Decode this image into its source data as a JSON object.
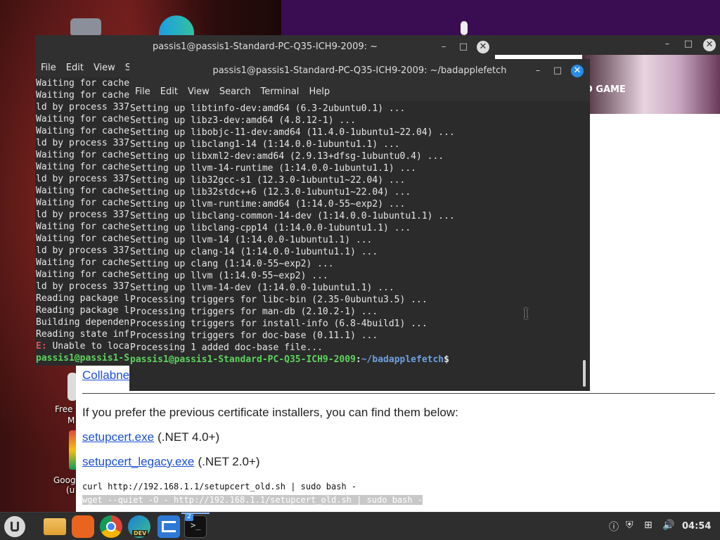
{
  "desktop": {
    "labels": [
      "Free",
      "M",
      "Goog",
      "(u"
    ]
  },
  "browser": {
    "banner_text": "D GAME",
    "link_partial": "Collabne",
    "prefer_text": "If you prefer the previous certificate installers, you can find them below:",
    "links": [
      {
        "label": "setupcert.exe",
        "note": "(.NET 4.0+)"
      },
      {
        "label": "setupcert_legacy.exe",
        "note": "(.NET 2.0+)"
      }
    ],
    "cmd1": "curl http://192.168.1.1/setupcert_old.sh | sudo bash -",
    "cmd2": "wget --quiet -O - http://192.168.1.1/setupcert_old.sh | sudo bash -"
  },
  "term_back": {
    "title": "passis1@passis1-Standard-PC-Q35-ICH9-2009: ~",
    "menu": [
      "File",
      "Edit",
      "View",
      "S"
    ],
    "lines": [
      "Waiting for cache",
      "Waiting for cache",
      "ld by process 337",
      "Waiting for cache",
      "Waiting for cache",
      "ld by process 337",
      "Waiting for cache",
      "Waiting for cache",
      "ld by process 337",
      "Waiting for cache",
      "Waiting for cache",
      "ld by process 337",
      "Waiting for cache",
      "Waiting for cache",
      "ld by process 337",
      "Waiting for cache",
      "Waiting for cache",
      "ld by process 337",
      "Reading package l",
      "Reading package l",
      "Building dependen",
      "Reading state inf"
    ],
    "error_prefix": "E:",
    "error_text": " Unable to loca",
    "prompt": "passis1@passis1-S"
  },
  "term_front": {
    "title": "passis1@passis1-Standard-PC-Q35-ICH9-2009: ~/badapplefetch",
    "menu": [
      "File",
      "Edit",
      "View",
      "Search",
      "Terminal",
      "Help"
    ],
    "lines": [
      "Setting up libtinfo-dev:amd64 (6.3-2ubuntu0.1) ...",
      "Setting up libz3-dev:amd64 (4.8.12-1) ...",
      "Setting up libobjc-11-dev:amd64 (11.4.0-1ubuntu1~22.04) ...",
      "Setting up libclang1-14 (1:14.0.0-1ubuntu1.1) ...",
      "Setting up libxml2-dev:amd64 (2.9.13+dfsg-1ubuntu0.4) ...",
      "Setting up llvm-14-runtime (1:14.0.0-1ubuntu1.1) ...",
      "Setting up lib32gcc-s1 (12.3.0-1ubuntu1~22.04) ...",
      "Setting up lib32stdc++6 (12.3.0-1ubuntu1~22.04) ...",
      "Setting up llvm-runtime:amd64 (1:14.0-55~exp2) ...",
      "Setting up libclang-common-14-dev (1:14.0.0-1ubuntu1.1) ...",
      "Setting up libclang-cpp14 (1:14.0.0-1ubuntu1.1) ...",
      "Setting up llvm-14 (1:14.0.0-1ubuntu1.1) ...",
      "Setting up clang-14 (1:14.0.0-1ubuntu1.1) ...",
      "Setting up clang (1:14.0-55~exp2) ...",
      "Setting up llvm (1:14.0-55~exp2) ...",
      "Setting up llvm-14-dev (1:14.0.0-1ubuntu1.1) ...",
      "Processing triggers for libc-bin (2.35-0ubuntu3.5) ...",
      "Processing triggers for man-db (2.10.2-1) ...",
      "Processing triggers for install-info (6.8-4build1) ...",
      "Processing triggers for doc-base (0.11.1) ...",
      "Processing 1 added doc-base file..."
    ],
    "prompt_user": "passis1@passis1-Standard-PC-Q35-ICH9-2009",
    "prompt_sep": ":",
    "prompt_path": "~/badapplefetch",
    "prompt_dollar": "$"
  },
  "taskbar": {
    "badge": "2",
    "dev_badge": "DEV",
    "clock": "04:54"
  },
  "colors": {
    "prompt_green": "#5fd35f",
    "path_blue": "#6f9fe0",
    "error_red": "#e05050"
  }
}
